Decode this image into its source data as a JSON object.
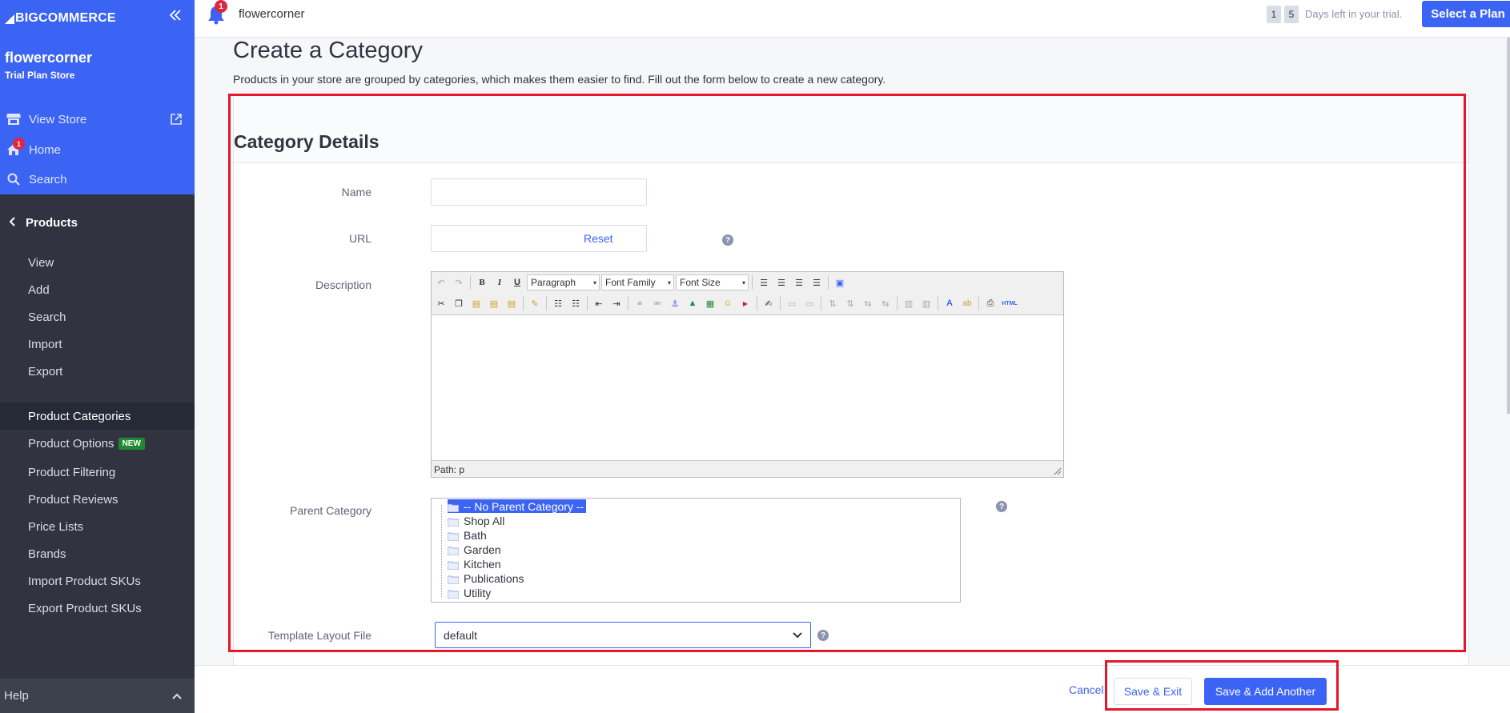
{
  "sidebar": {
    "logo": "BIGCOMMERCE",
    "store_name": "flowercorner",
    "store_plan": "Trial Plan Store",
    "top_links": [
      {
        "label": "View Store"
      },
      {
        "label": "Home",
        "badge": "1"
      },
      {
        "label": "Search"
      }
    ],
    "section": "Products",
    "items": [
      {
        "label": "View"
      },
      {
        "label": "Add"
      },
      {
        "label": "Search"
      },
      {
        "label": "Import"
      },
      {
        "label": "Export"
      },
      {
        "label": "Product Categories"
      },
      {
        "label": "Product Options",
        "badge": "NEW"
      },
      {
        "label": "Product Filtering"
      },
      {
        "label": "Product Reviews"
      },
      {
        "label": "Price Lists"
      },
      {
        "label": "Brands"
      },
      {
        "label": "Import Product SKUs"
      },
      {
        "label": "Export Product SKUs"
      }
    ],
    "help": "Help"
  },
  "topbar": {
    "notification_count": "1",
    "store_name": "flowercorner",
    "trial_digits": [
      "1",
      "5"
    ],
    "trial_text": "Days left in your trial.",
    "select_plan": "Select a Plan"
  },
  "page": {
    "title": "Create a Category",
    "description": "Products in your store are grouped by categories, which makes them easier to find. Fill out the form below to create a new category.",
    "card_title": "Category Details"
  },
  "form": {
    "name_label": "Name",
    "name_value": "",
    "url_label": "URL",
    "url_value": "",
    "reset": "Reset",
    "description_label": "Description",
    "editor": {
      "format": "Paragraph",
      "font_family": "Font Family",
      "font_size": "Font Size",
      "path": "Path: p",
      "bold": "B",
      "italic": "I",
      "underline": "U",
      "html": "HTML"
    },
    "parent_label": "Parent Category",
    "parent_options": [
      "-- No Parent Category --",
      "Shop All",
      "Bath",
      "Garden",
      "Kitchen",
      "Publications",
      "Utility"
    ],
    "template_label": "Template Layout File",
    "template_value": "default"
  },
  "footer": {
    "cancel": "Cancel",
    "save_exit": "Save & Exit",
    "save_add": "Save & Add Another"
  },
  "colors": {
    "brand": "#3c64f4",
    "sidebar": "#313440",
    "highlight": "#e5172c"
  }
}
